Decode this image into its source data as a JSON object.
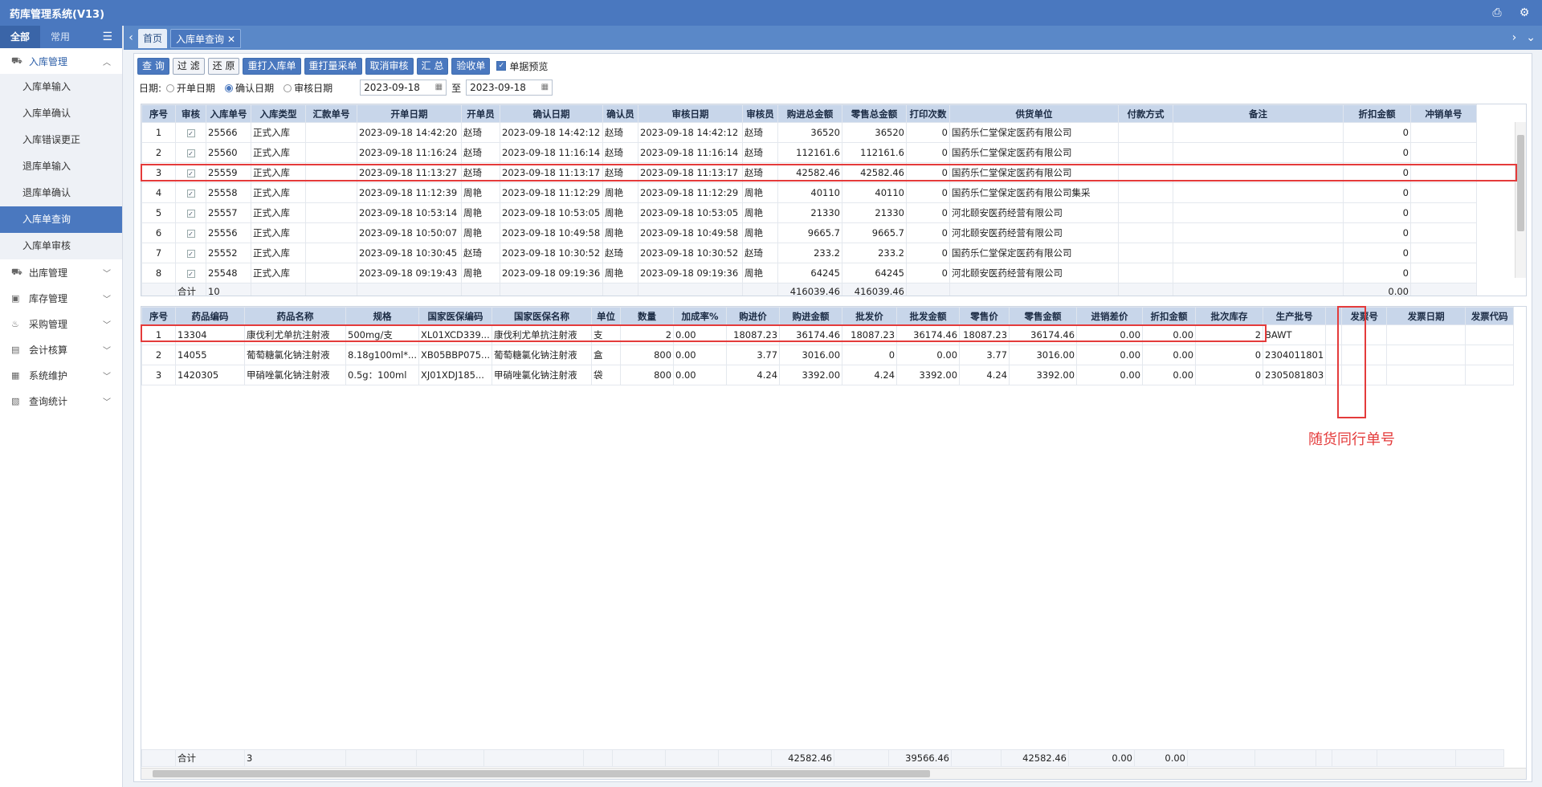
{
  "app": {
    "title": "药库管理系统(V13)"
  },
  "sidebar": {
    "tabs": [
      "全部",
      "常用"
    ],
    "groups": [
      {
        "label": "入库管理",
        "open": true
      },
      {
        "label": "出库管理"
      },
      {
        "label": "库存管理"
      },
      {
        "label": "采购管理"
      },
      {
        "label": "会计核算"
      },
      {
        "label": "系统维护"
      },
      {
        "label": "查询统计"
      }
    ],
    "items": [
      "入库单输入",
      "入库单确认",
      "入库错误更正",
      "退库单输入",
      "退库单确认",
      "入库单查询",
      "入库单审核"
    ]
  },
  "tabs": {
    "home": "首页",
    "current": "入库单查询"
  },
  "toolbar": {
    "buttons": [
      "查 询",
      "过 滤",
      "还 原",
      "重打入库单",
      "重打量采单",
      "取消审核",
      "汇 总",
      "验收单"
    ],
    "preview_label": "单据预览"
  },
  "filter": {
    "label": "日期:",
    "options": [
      "开单日期",
      "确认日期",
      "审核日期"
    ],
    "from": "2023-09-18",
    "sep": "至",
    "to": "2023-09-18"
  },
  "top_table": {
    "headers": [
      "序号",
      "审核",
      "入库单号",
      "入库类型",
      "汇款单号",
      "开单日期",
      "开单员",
      "确认日期",
      "确认员",
      "审核日期",
      "审核员",
      "购进总金额",
      "零售总金额",
      "打印次数",
      "供货单位",
      "付款方式",
      "备注",
      "折扣金额",
      "冲销单号"
    ],
    "rows": [
      [
        "1",
        "✓",
        "25566",
        "正式入库",
        "",
        "2023-09-18 14:42:20",
        "赵琦",
        "2023-09-18 14:42:12",
        "赵琦",
        "2023-09-18 14:42:12",
        "赵琦",
        "36520",
        "36520",
        "0",
        "国药乐仁堂保定医药有限公司",
        "",
        "",
        "0",
        ""
      ],
      [
        "2",
        "✓",
        "25560",
        "正式入库",
        "",
        "2023-09-18 11:16:24",
        "赵琦",
        "2023-09-18 11:16:14",
        "赵琦",
        "2023-09-18 11:16:14",
        "赵琦",
        "112161.6",
        "112161.6",
        "0",
        "国药乐仁堂保定医药有限公司",
        "",
        "",
        "0",
        ""
      ],
      [
        "3",
        "✓",
        "25559",
        "正式入库",
        "",
        "2023-09-18 11:13:27",
        "赵琦",
        "2023-09-18 11:13:17",
        "赵琦",
        "2023-09-18 11:13:17",
        "赵琦",
        "42582.46",
        "42582.46",
        "0",
        "国药乐仁堂保定医药有限公司",
        "",
        "",
        "0",
        ""
      ],
      [
        "4",
        "✓",
        "25558",
        "正式入库",
        "",
        "2023-09-18 11:12:39",
        "周艳",
        "2023-09-18 11:12:29",
        "周艳",
        "2023-09-18 11:12:29",
        "周艳",
        "40110",
        "40110",
        "0",
        "国药乐仁堂保定医药有限公司集采",
        "",
        "",
        "0",
        ""
      ],
      [
        "5",
        "✓",
        "25557",
        "正式入库",
        "",
        "2023-09-18 10:53:14",
        "周艳",
        "2023-09-18 10:53:05",
        "周艳",
        "2023-09-18 10:53:05",
        "周艳",
        "21330",
        "21330",
        "0",
        "河北颐安医药经营有限公司",
        "",
        "",
        "0",
        ""
      ],
      [
        "6",
        "✓",
        "25556",
        "正式入库",
        "",
        "2023-09-18 10:50:07",
        "周艳",
        "2023-09-18 10:49:58",
        "周艳",
        "2023-09-18 10:49:58",
        "周艳",
        "9665.7",
        "9665.7",
        "0",
        "河北颐安医药经营有限公司",
        "",
        "",
        "0",
        ""
      ],
      [
        "7",
        "✓",
        "25552",
        "正式入库",
        "",
        "2023-09-18 10:30:45",
        "赵琦",
        "2023-09-18 10:30:52",
        "赵琦",
        "2023-09-18 10:30:52",
        "赵琦",
        "233.2",
        "233.2",
        "0",
        "国药乐仁堂保定医药有限公司",
        "",
        "",
        "0",
        ""
      ],
      [
        "8",
        "✓",
        "25548",
        "正式入库",
        "",
        "2023-09-18 09:19:43",
        "周艳",
        "2023-09-18 09:19:36",
        "周艳",
        "2023-09-18 09:19:36",
        "周艳",
        "64245",
        "64245",
        "0",
        "河北颐安医药经营有限公司",
        "",
        "",
        "0",
        ""
      ]
    ],
    "summary": {
      "label": "合计",
      "count": "10",
      "purchase_total": "416039.46",
      "retail_total": "416039.46",
      "discount_total": "0.00"
    }
  },
  "bottom_table": {
    "headers": [
      "序号",
      "药品编码",
      "药品名称",
      "规格",
      "国家医保编码",
      "国家医保名称",
      "单位",
      "数量",
      "加成率%",
      "购进价",
      "购进金额",
      "批发价",
      "批发金额",
      "零售价",
      "零售金额",
      "进销差价",
      "折扣金额",
      "批次库存",
      "生产批号",
      "",
      "发票号",
      "发票日期",
      "发票代码"
    ],
    "rows": [
      [
        "1",
        "13304",
        "康伐利尤单抗注射液",
        "500mg/支",
        "XL01XCD339...",
        "康伐利尤单抗注射液",
        "支",
        "2",
        "0.00",
        "18087.23",
        "36174.46",
        "18087.23",
        "36174.46",
        "18087.23",
        "36174.46",
        "0.00",
        "0.00",
        "2",
        "BAWT",
        "",
        "",
        "",
        ""
      ],
      [
        "2",
        "14055",
        "葡萄糖氯化钠注射液",
        "8.18g100ml*...",
        "XB05BBP075...",
        "葡萄糖氯化钠注射液",
        "盒",
        "800",
        "0.00",
        "3.77",
        "3016.00",
        "0",
        "0.00",
        "3.77",
        "3016.00",
        "0.00",
        "0.00",
        "0",
        "2304011801",
        "",
        "",
        "",
        ""
      ],
      [
        "3",
        "1420305",
        "甲硝唑氯化钠注射液",
        "0.5g：100ml",
        "XJ01XDJ185...",
        "甲硝唑氯化钠注射液",
        "袋",
        "800",
        "0.00",
        "4.24",
        "3392.00",
        "4.24",
        "3392.00",
        "4.24",
        "3392.00",
        "0.00",
        "0.00",
        "0",
        "2305081803",
        "",
        "",
        "",
        ""
      ]
    ],
    "summary": {
      "label": "合计",
      "count": "3",
      "purchase_total": "42582.46",
      "wholesale_total": "39566.46",
      "retail_total": "42582.46",
      "margin_total": "0.00",
      "discount_total": "0.00"
    }
  },
  "annotation": {
    "text": "随货同行单号",
    "color": "#e43b3b"
  }
}
